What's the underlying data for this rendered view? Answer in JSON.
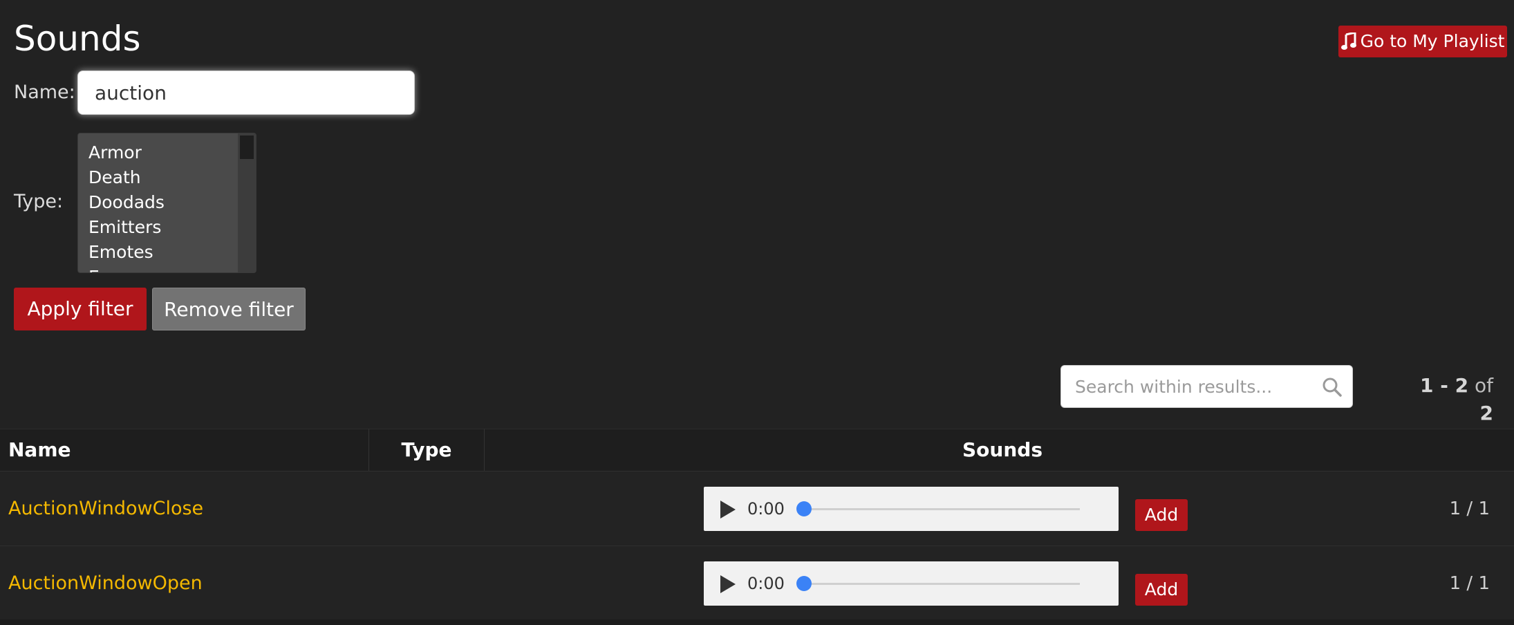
{
  "page": {
    "title": "Sounds",
    "playlist_button": "Go to My Playlist"
  },
  "filter": {
    "name_label": "Name:",
    "name_value": "auction",
    "type_label": "Type:",
    "type_options": [
      "Armor",
      "Death",
      "Doodads",
      "Emitters",
      "Emotes",
      "E..."
    ],
    "apply_label": "Apply filter",
    "remove_label": "Remove filter"
  },
  "results": {
    "search_placeholder": "Search within results...",
    "pager_range": "1 - 2",
    "pager_of": "of",
    "pager_total": "2"
  },
  "table": {
    "headers": {
      "name": "Name",
      "type": "Type",
      "sounds": "Sounds"
    },
    "rows": [
      {
        "name": "AuctionWindowClose",
        "type": "",
        "audio_time": "0:00",
        "add_label": "Add",
        "count": "1 / 1"
      },
      {
        "name": "AuctionWindowOpen",
        "type": "",
        "audio_time": "0:00",
        "add_label": "Add",
        "count": "1 / 1"
      }
    ]
  },
  "colors": {
    "background": "#222222",
    "accent_red": "#b0161b",
    "link_yellow": "#f4b800",
    "audio_thumb": "#3b82f6"
  },
  "icons": {
    "playlist": "music-note-icon",
    "search": "search-icon",
    "play": "play-icon"
  }
}
